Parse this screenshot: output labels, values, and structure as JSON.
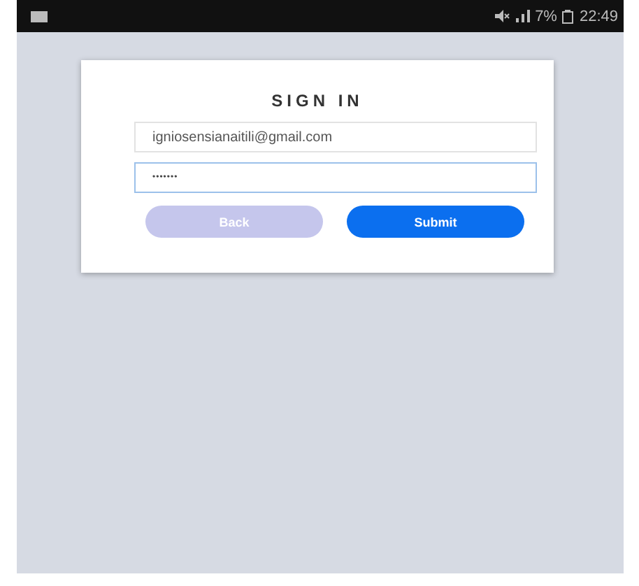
{
  "status_bar": {
    "battery": "7%",
    "time": "22:49"
  },
  "card": {
    "title": "SIGN IN",
    "fields": [
      {
        "kind": "email",
        "value": "igniosensianaitili@gmail.com",
        "focused": false
      },
      {
        "kind": "password",
        "value": "•••••••",
        "focused": true
      }
    ],
    "buttons": [
      {
        "label": "Back",
        "disabled": true
      },
      {
        "label": "Submit",
        "disabled": false
      }
    ]
  }
}
